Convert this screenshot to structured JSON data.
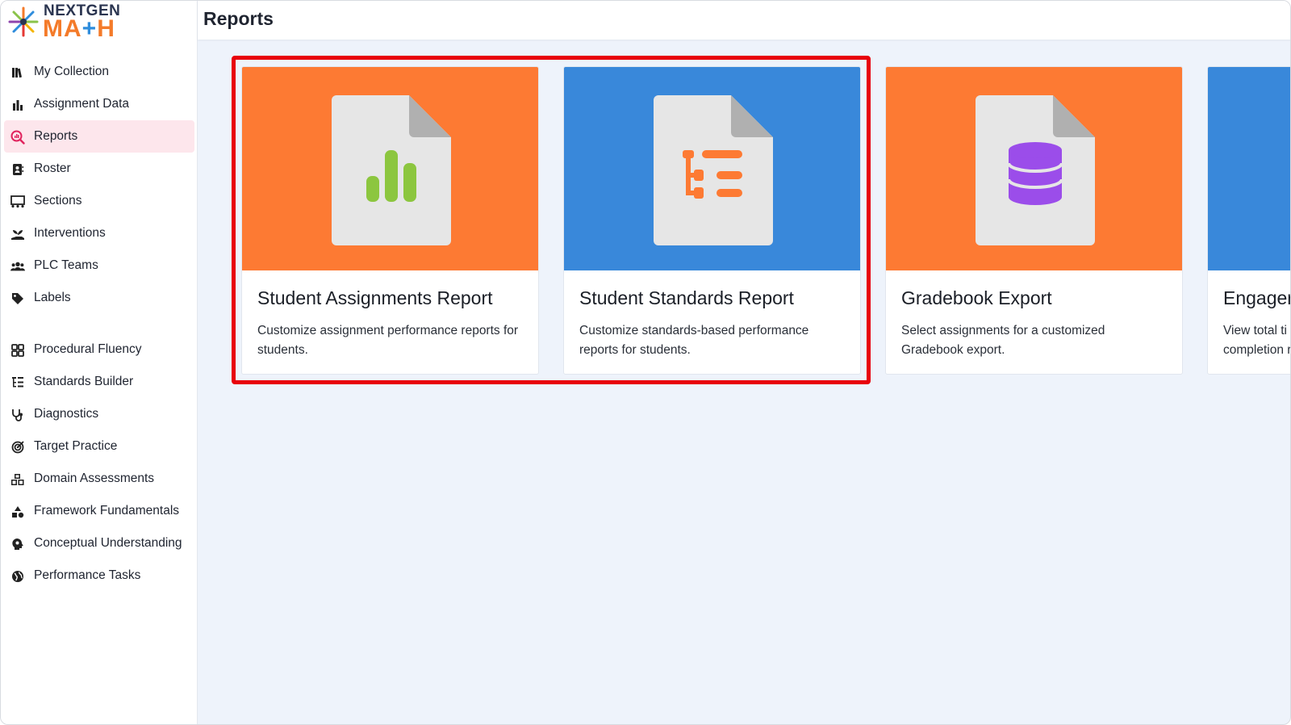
{
  "app": {
    "logo_top": "NEXTGEN",
    "logo_bottom": "MATH"
  },
  "header": {
    "title": "Reports"
  },
  "sidebar": {
    "items": [
      {
        "label": "My Collection",
        "icon": "books-icon"
      },
      {
        "label": "Assignment Data",
        "icon": "bar-chart-icon"
      },
      {
        "label": "Reports",
        "icon": "report-search-icon",
        "active": true
      },
      {
        "label": "Roster",
        "icon": "contact-book-icon"
      },
      {
        "label": "Sections",
        "icon": "classroom-icon"
      },
      {
        "label": "Interventions",
        "icon": "hand-seedling-icon"
      },
      {
        "label": "PLC Teams",
        "icon": "users-icon"
      },
      {
        "label": "Labels",
        "icon": "tag-icon"
      }
    ],
    "tools": [
      {
        "label": "Procedural Fluency",
        "icon": "grid-icon"
      },
      {
        "label": "Standards Builder",
        "icon": "list-tree-icon"
      },
      {
        "label": "Diagnostics",
        "icon": "stethoscope-icon"
      },
      {
        "label": "Target Practice",
        "icon": "target-icon"
      },
      {
        "label": "Domain Assessments",
        "icon": "cubes-icon"
      },
      {
        "label": "Framework Fundamentals",
        "icon": "shapes-icon"
      },
      {
        "label": "Conceptual Understanding",
        "icon": "brain-head-icon"
      },
      {
        "label": "Performance Tasks",
        "icon": "globe-icon"
      }
    ]
  },
  "cards": [
    {
      "title": "Student Assignments Report",
      "desc": "Customize assignment performance reports for students.",
      "color": "#fd7a33",
      "icon": "bar-chart-document-icon"
    },
    {
      "title": "Student Standards Report",
      "desc": "Customize standards-based performance reports for students.",
      "color": "#3988da",
      "icon": "list-tree-document-icon"
    },
    {
      "title": "Gradebook Export",
      "desc": "Select assignments for a customized Gradebook export.",
      "color": "#fd7a33",
      "icon": "database-document-icon"
    },
    {
      "title": "Engager",
      "desc": "View total ti completion r",
      "color": "#3988da",
      "icon": "document-icon"
    }
  ],
  "colors": {
    "active_bg": "#fde6ec",
    "highlight": "#e8000b",
    "orange": "#fd7a33",
    "blue": "#3988da"
  }
}
